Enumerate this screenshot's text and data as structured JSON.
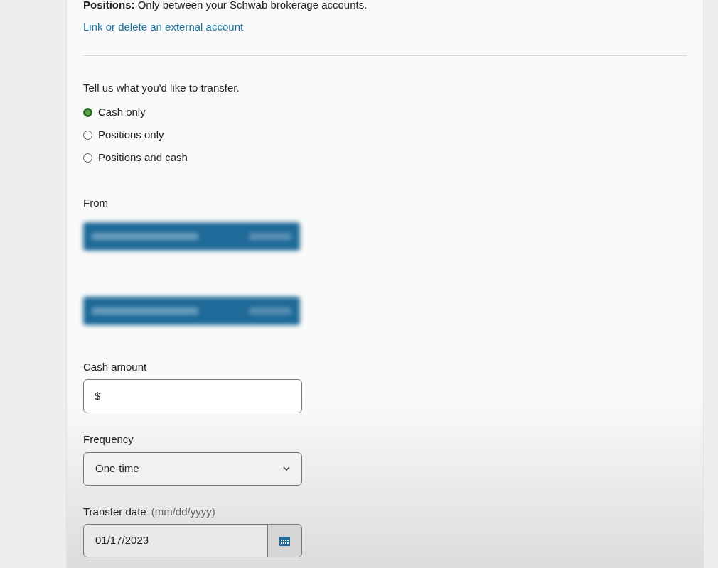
{
  "notice": {
    "text": "**Positions:** Only between your Schwab brokerage accounts."
  },
  "link": "Link or delete an external account",
  "transfer_type": {
    "prompt": "Tell us what you'd like to transfer.",
    "options": [
      {
        "label": "Cash only",
        "selected": true
      },
      {
        "label": "Positions only",
        "selected": false
      },
      {
        "label": "Positions and cash",
        "selected": false
      }
    ]
  },
  "from": {
    "label": "From"
  },
  "cash_amount": {
    "label": "Cash amount",
    "prefix": "$"
  },
  "frequency": {
    "label": "Frequency",
    "value": "One-time"
  },
  "transfer_date": {
    "label": "Transfer date",
    "hint": "(mm/dd/yyyy)",
    "value": "01/17/2023"
  }
}
